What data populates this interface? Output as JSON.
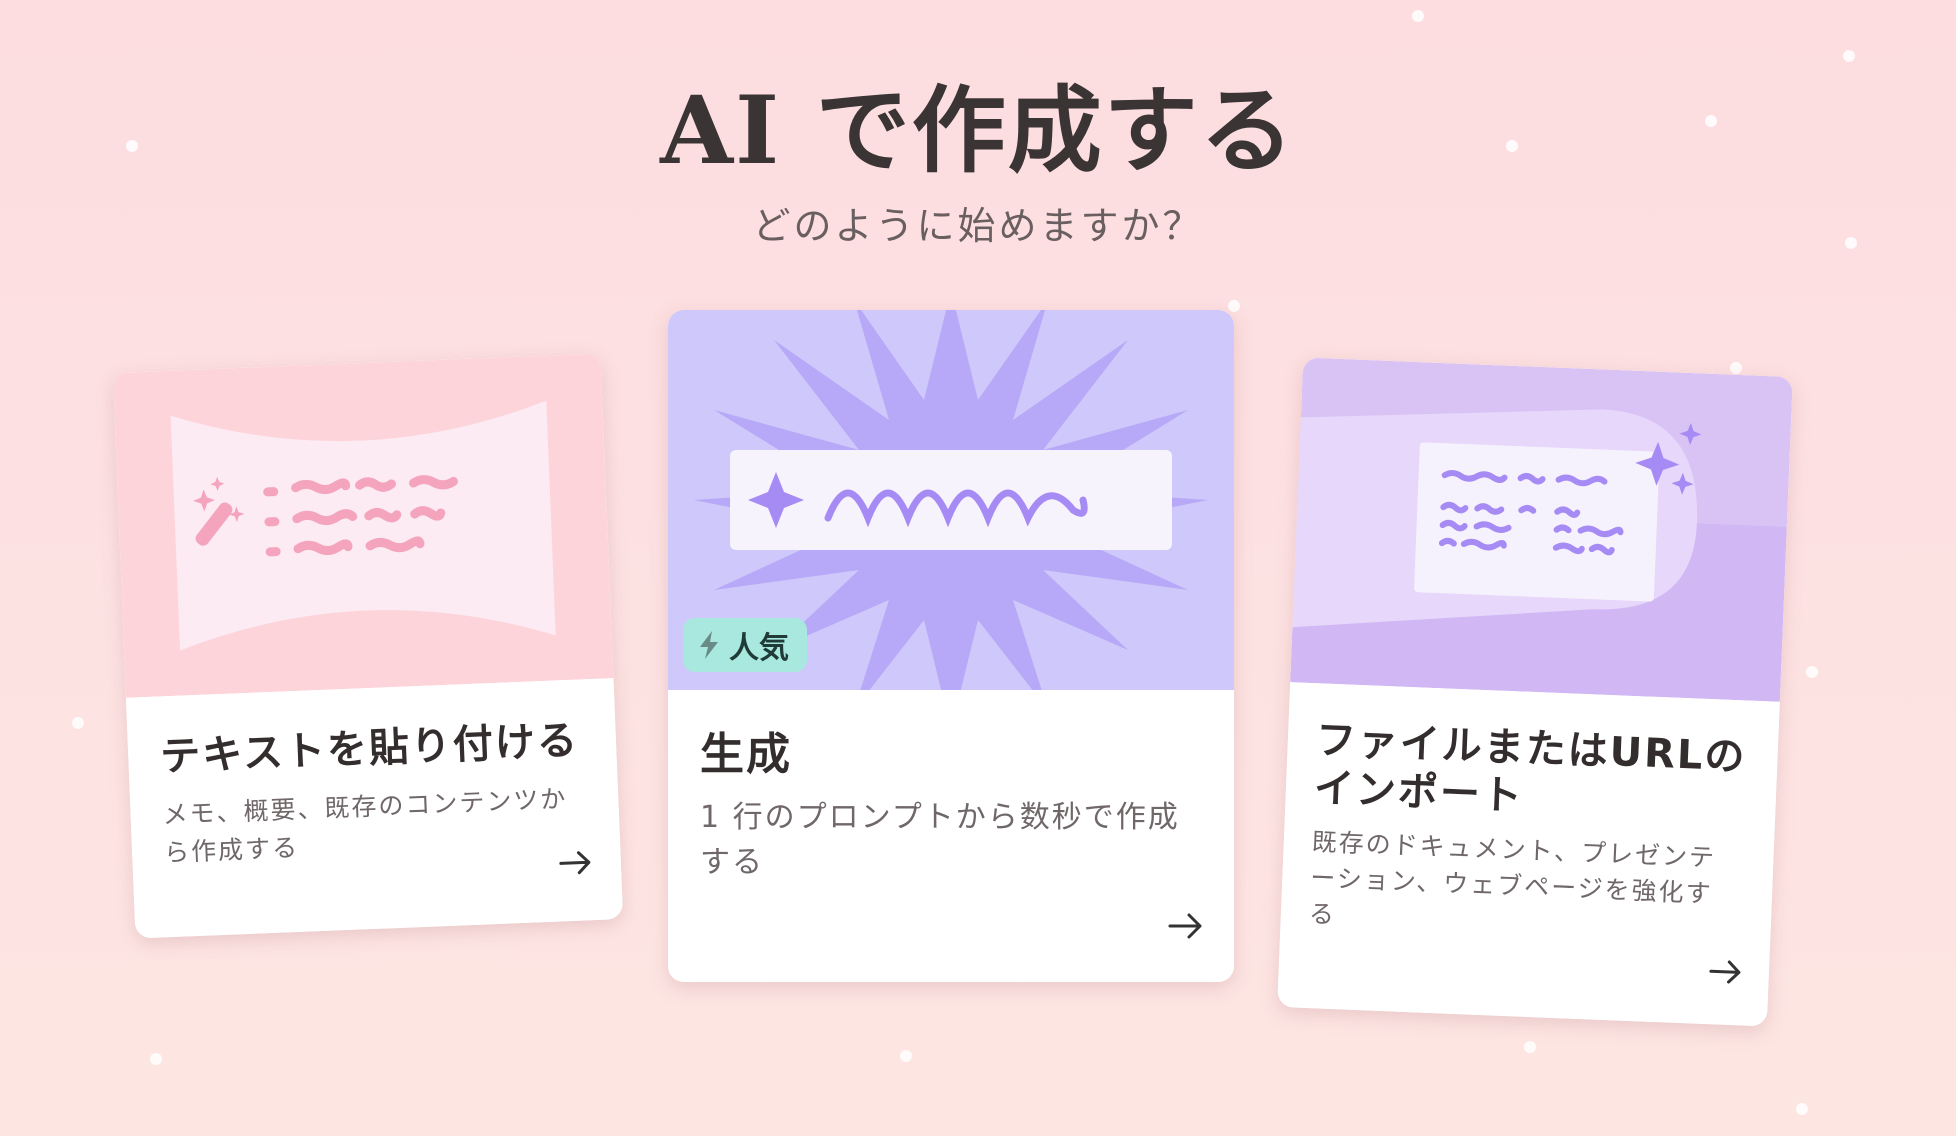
{
  "hero": {
    "title": "AI で作成する",
    "subtitle": "どのように始めますか？"
  },
  "cards": [
    {
      "title": "テキストを貼り付ける",
      "description_line1": "メモ、概要、既存のコンテンツか",
      "description_line2": "ら作成する",
      "icon": "magic-wand-icon",
      "accent": "#f4a5bd"
    },
    {
      "title": "生成",
      "description_line1": "1 行のプロンプトから数秒で作成",
      "description_line2": "する",
      "badge": "人気",
      "badge_icon": "lightning-icon",
      "accent": "#b7a9f7"
    },
    {
      "title_line1": "ファイルまたはURLの",
      "title_line2": "インポート",
      "description_line1": "既存のドキュメント、プレゼンテ",
      "description_line2": "ーション、ウェブページを強化す",
      "description_line3": "る",
      "accent": "#c4a8f0"
    }
  ]
}
